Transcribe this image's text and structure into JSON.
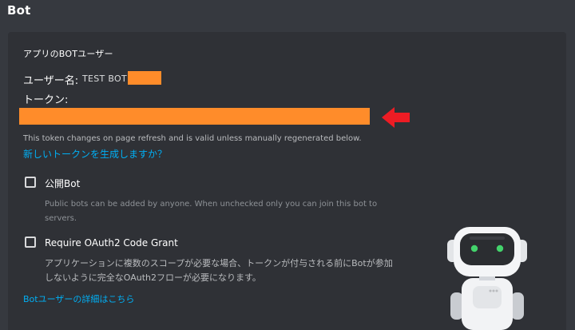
{
  "header": {
    "title": "Bot"
  },
  "bot_section": {
    "title": "アプリのBOTユーザー",
    "username_label": "ユーザー名:",
    "username_value": "TEST BOT",
    "token_label": "トークン:",
    "token_note": "This token changes on page refresh and is valid unless manually regenerated below.",
    "regenerate_link": "新しいトークンを生成しますか？"
  },
  "options": {
    "public_bot": {
      "label": "公開Bot",
      "checked": false,
      "description": "Public bots can be added by anyone. When unchecked only you can join this bot to servers."
    },
    "oauth2_grant": {
      "label": "Require OAuth2 Code Grant",
      "checked": false,
      "description": "アプリケーションに複数のスコープが必要な場合、トークンが付与される前にBotが参加しないように完全なOAuth2フローが必要になります。"
    }
  },
  "footer_link": "Botユーザーの詳細はこちら",
  "colors": {
    "page_bg": "#36393f",
    "panel_bg": "#2f3136",
    "link": "#00aff4",
    "redaction": "#ff8c2a",
    "annotation_arrow": "#ed1c24"
  },
  "icons": {
    "annotation_arrow": "arrow-left-icon",
    "illustration": "robot-illustration"
  }
}
